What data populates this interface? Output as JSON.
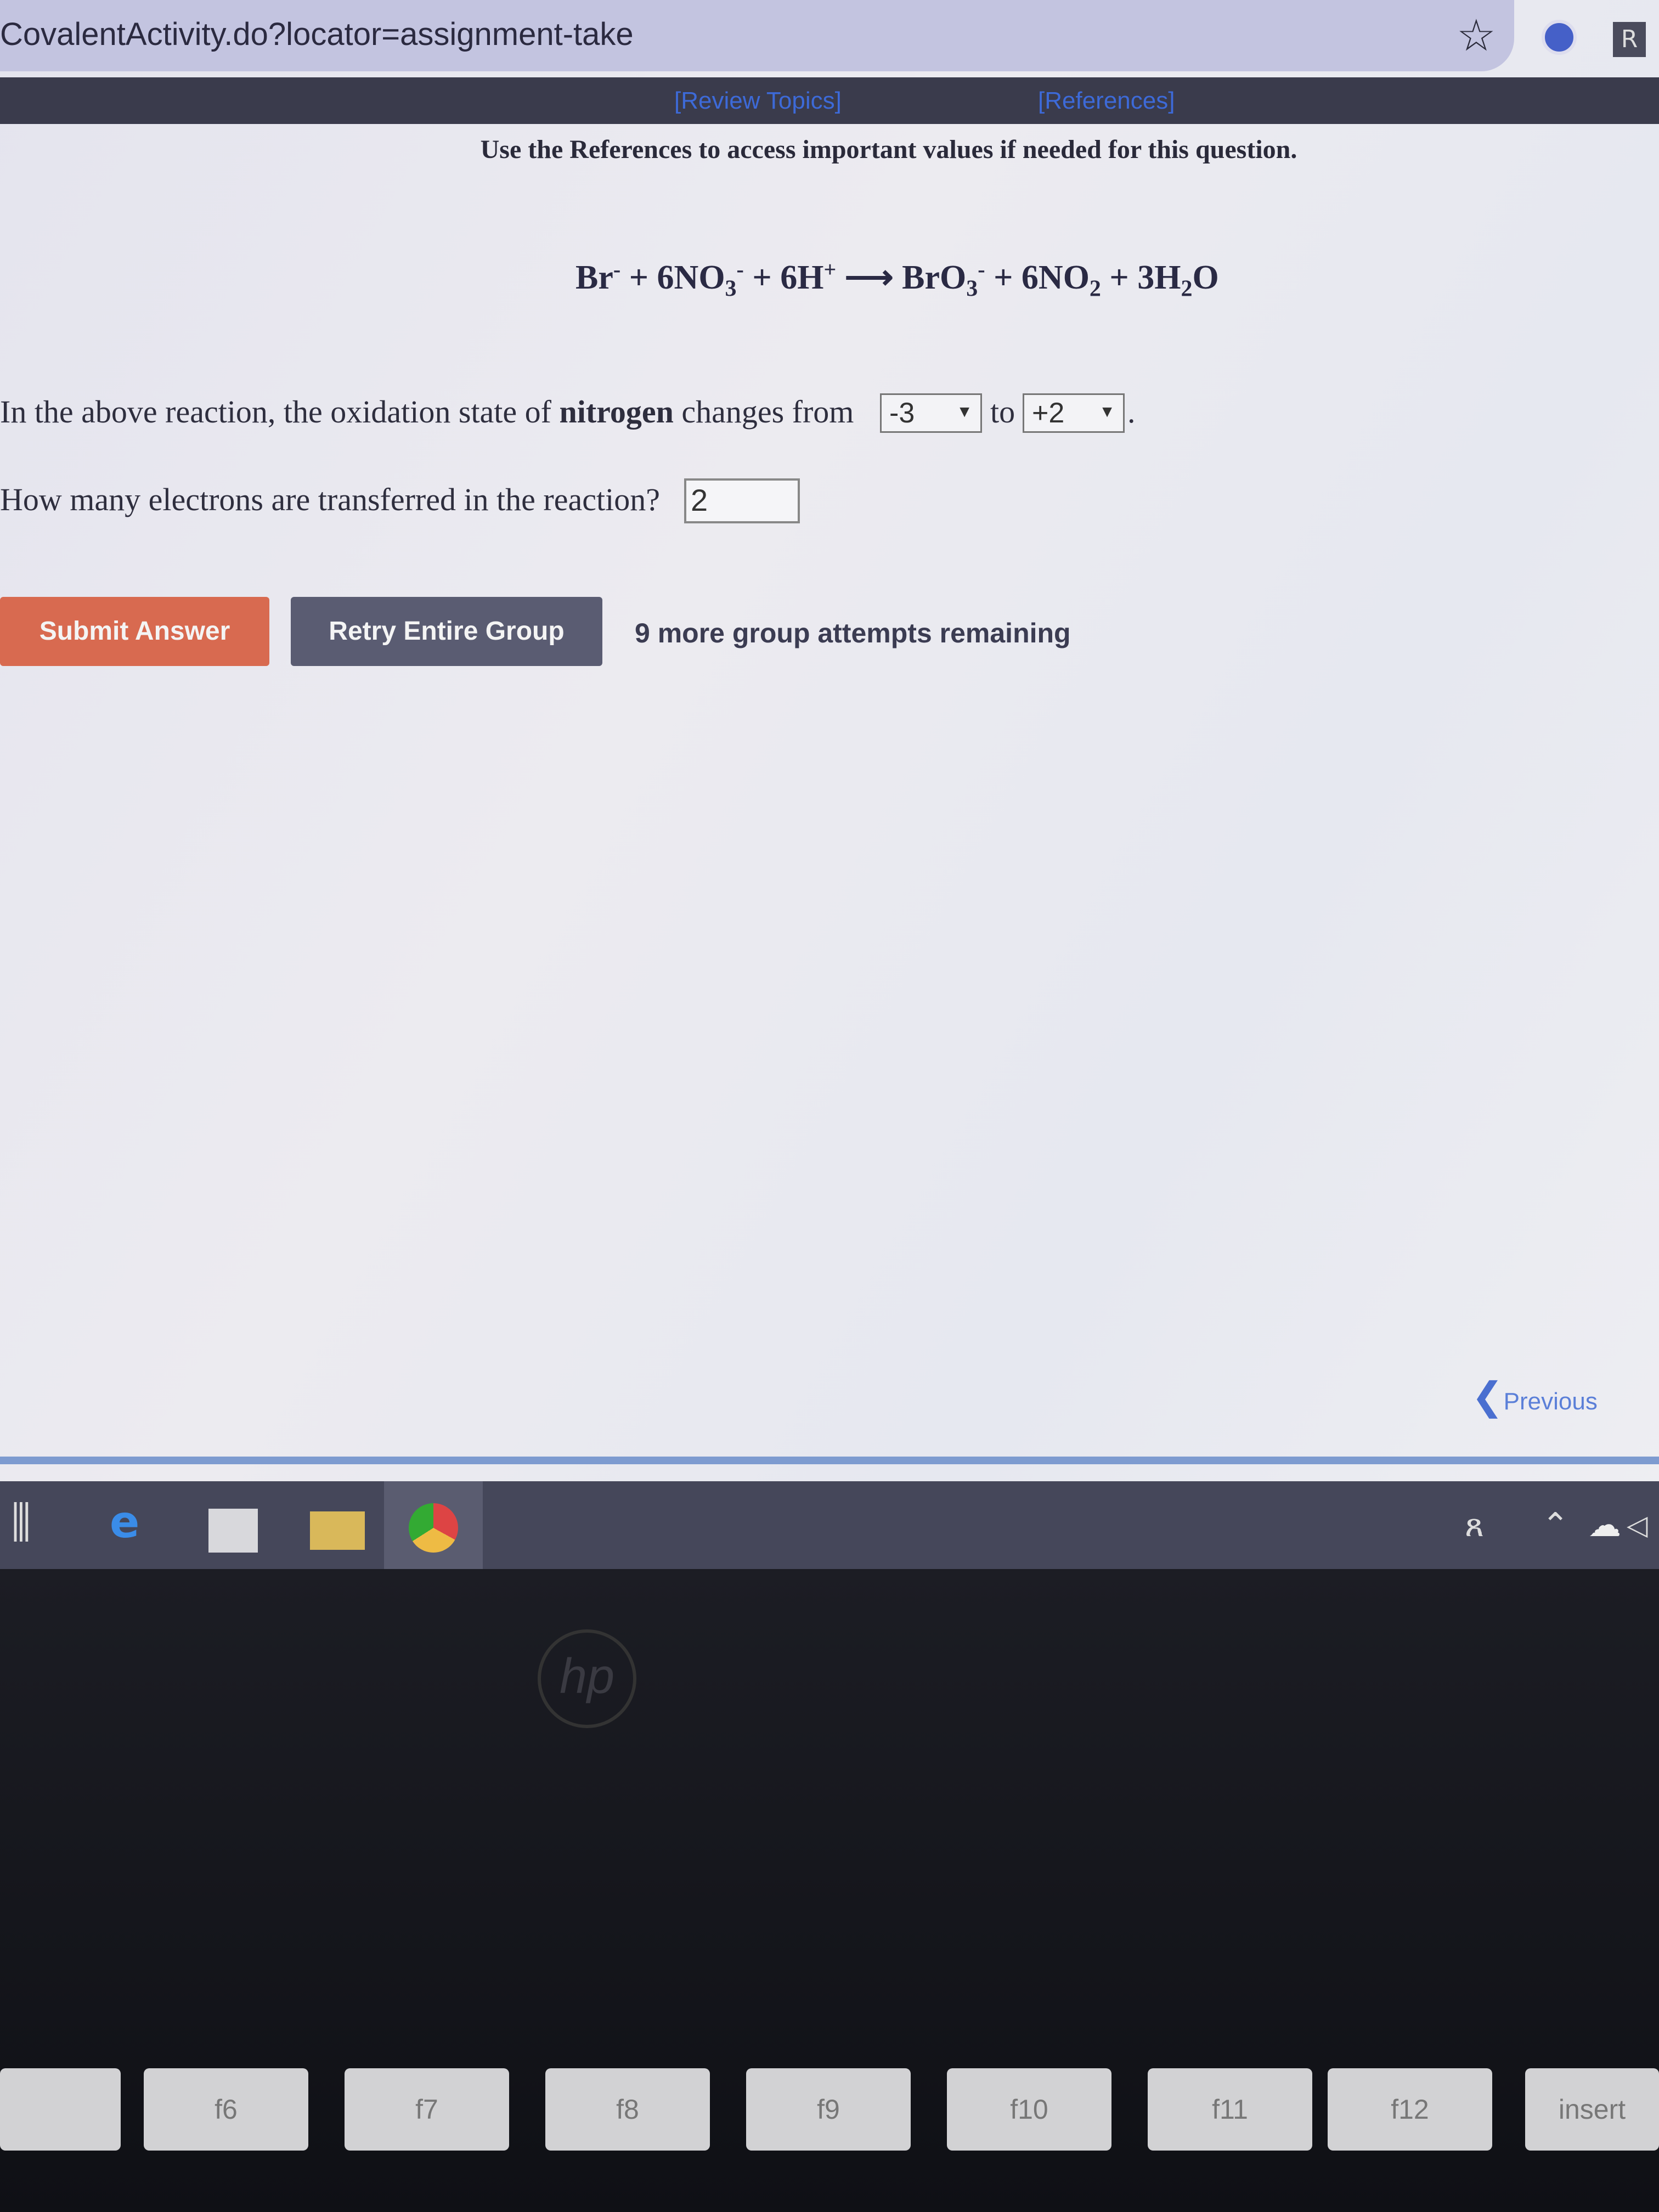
{
  "browser": {
    "url": "CovalentActivity.do?locator=assignment-take",
    "icons": [
      "star-icon",
      "extension-icon",
      "profile-icon"
    ]
  },
  "nav": {
    "review_topics": "[Review Topics]",
    "references": "[References]"
  },
  "instruction": "Use the References to access important values if needed for this question.",
  "equation": {
    "reactants": [
      {
        "text": "Br",
        "sup": "-"
      },
      {
        "text": "6NO",
        "sub": "3",
        "sup": "-"
      },
      {
        "text": "6H",
        "sup": "+"
      }
    ],
    "products": [
      {
        "text": "BrO",
        "sub": "3",
        "sup": "-"
      },
      {
        "text": "6NO",
        "sub": "2"
      },
      {
        "text": "3H",
        "sub": "2",
        "tail": "O"
      }
    ],
    "plus": "+",
    "arrow": "⟶"
  },
  "question1": {
    "prefix": "In the above reaction, the oxidation state of ",
    "bold": "nitrogen",
    "middle": " changes from",
    "from_value": "-3",
    "to_label": "to",
    "to_value": "+2",
    "end": "."
  },
  "question2": {
    "text": "How many electrons are transferred in the reaction?",
    "answer": "2"
  },
  "actions": {
    "submit": "Submit Answer",
    "retry": "Retry Entire Group",
    "attempts": "9 more group attempts remaining",
    "previous": "Previous"
  },
  "colors": {
    "submit": "#d86a50",
    "retry": "#5a5c72",
    "link": "#3d6ad8"
  },
  "keyboard": {
    "keys": [
      "f6",
      "f7",
      "f8",
      "f9",
      "f10",
      "f11",
      "f12",
      "insert"
    ]
  }
}
